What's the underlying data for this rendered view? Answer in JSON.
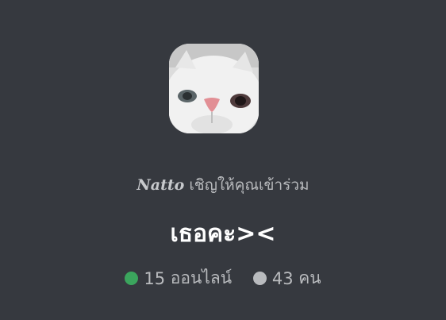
{
  "invite": {
    "inviter_name": "Natto",
    "invite_text": "เชิญให้คุณเข้าร่วม",
    "server_name": "เธอคะ><",
    "online_count": "15",
    "online_label": "ออนไลน์",
    "member_count": "43",
    "member_label": "คน"
  },
  "icons": {
    "server_icon": "cat-face-photo",
    "online_dot": "green-status-dot",
    "members_dot": "gray-status-dot"
  },
  "colors": {
    "background": "#36393f",
    "online": "#3ba55d",
    "muted_text": "#b9bbbe"
  }
}
